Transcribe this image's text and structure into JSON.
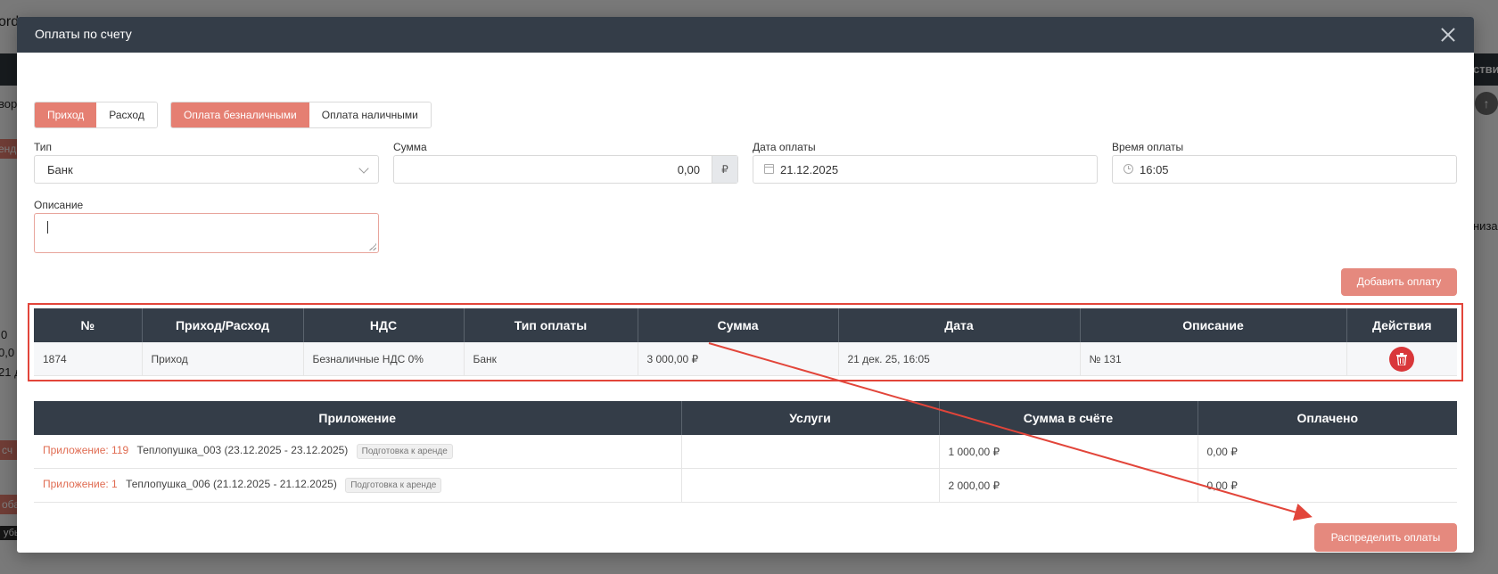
{
  "modal": {
    "title": "Оплаты по счету"
  },
  "direction_toggle": {
    "options": [
      "Приход",
      "Расход"
    ],
    "active": "Приход"
  },
  "payment_method_toggle": {
    "options": [
      "Оплата безналичными",
      "Оплата наличными"
    ],
    "active": "Оплата безналичными"
  },
  "form": {
    "type_label": "Тип",
    "type_value": "Банк",
    "sum_label": "Сумма",
    "sum_value": "0,00",
    "sum_currency": "₽",
    "date_label": "Дата оплаты",
    "date_value": "21.12.2025",
    "time_label": "Время оплаты",
    "time_value": "16:05",
    "description_label": "Описание",
    "description_value": ""
  },
  "buttons": {
    "add_payment": "Добавить оплату",
    "distribute_payments": "Распределить оплаты"
  },
  "payments_table": {
    "headers": [
      "№",
      "Приход/Расход",
      "НДС",
      "Тип оплаты",
      "Сумма",
      "Дата",
      "Описание",
      "Действия"
    ],
    "rows": [
      [
        "1874",
        "Приход",
        "Безналичные НДС 0%",
        "Банк",
        "3 000,00 ₽",
        "21 дек. 25, 16:05",
        "№ 131"
      ]
    ]
  },
  "attachments_table": {
    "headers": [
      "Приложение",
      "Услуги",
      "Сумма в счёте",
      "Оплачено"
    ],
    "rows": [
      {
        "link": "Приложение: 119",
        "name": "Теплопушка_003 (23.12.2025 - 23.12.2025)",
        "status": "Подготовка к аренде",
        "services": "",
        "sum": "1 000,00 ₽",
        "paid": "0,00 ₽"
      },
      {
        "link": "Приложение: 1",
        "name": "Теплопушка_006 (21.12.2025 - 21.12.2025)",
        "status": "Подготовка к аренде",
        "services": "",
        "sum": "2 000,00 ₽",
        "paid": "0,00 ₽"
      }
    ]
  },
  "background": {
    "fragments": [
      "ord",
      "вор",
      "енд",
      "0",
      "0,0",
      "21 д",
      "сч",
      "оба",
      "убь",
      "ствия",
      "низа"
    ]
  },
  "colors": {
    "header_dark": "#343d48",
    "accent": "#e5897e",
    "danger": "#d9373a",
    "link": "#e06c52",
    "highlight": "#e2453a"
  }
}
